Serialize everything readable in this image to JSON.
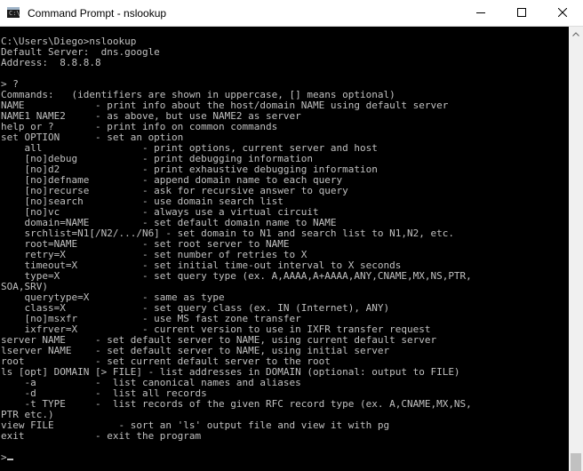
{
  "window": {
    "title": "Command Prompt - nslookup",
    "icon": "command-prompt-icon"
  },
  "console": {
    "lines": [
      "C:\\Users\\Diego>nslookup",
      "Default Server:  dns.google",
      "Address:  8.8.8.8",
      "",
      "> ?",
      "Commands:   (identifiers are shown in uppercase, [] means optional)",
      "NAME            - print info about the host/domain NAME using default server",
      "NAME1 NAME2     - as above, but use NAME2 as server",
      "help or ?       - print info on common commands",
      "set OPTION      - set an option",
      "    all                 - print options, current server and host",
      "    [no]debug           - print debugging information",
      "    [no]d2              - print exhaustive debugging information",
      "    [no]defname         - append domain name to each query",
      "    [no]recurse         - ask for recursive answer to query",
      "    [no]search          - use domain search list",
      "    [no]vc              - always use a virtual circuit",
      "    domain=NAME         - set default domain name to NAME",
      "    srchlist=N1[/N2/.../N6] - set domain to N1 and search list to N1,N2, etc.",
      "    root=NAME           - set root server to NAME",
      "    retry=X             - set number of retries to X",
      "    timeout=X           - set initial time-out interval to X seconds",
      "    type=X              - set query type (ex. A,AAAA,A+AAAA,ANY,CNAME,MX,NS,PTR,",
      "SOA,SRV)",
      "    querytype=X         - same as type",
      "    class=X             - set query class (ex. IN (Internet), ANY)",
      "    [no]msxfr           - use MS fast zone transfer",
      "    ixfrver=X           - current version to use in IXFR transfer request",
      "server NAME     - set default server to NAME, using current default server",
      "lserver NAME    - set default server to NAME, using initial server",
      "root            - set current default server to the root",
      "ls [opt] DOMAIN [> FILE] - list addresses in DOMAIN (optional: output to FILE)",
      "    -a          -  list canonical names and aliases",
      "    -d          -  list all records",
      "    -t TYPE     -  list records of the given RFC record type (ex. A,CNAME,MX,NS,",
      "PTR etc.)",
      "view FILE           - sort an 'ls' output file and view it with pg",
      "exit            - exit the program",
      "",
      ">"
    ]
  },
  "colors": {
    "background": "#000000",
    "text": "#c0c0c0",
    "titlebar": "#ffffff"
  }
}
